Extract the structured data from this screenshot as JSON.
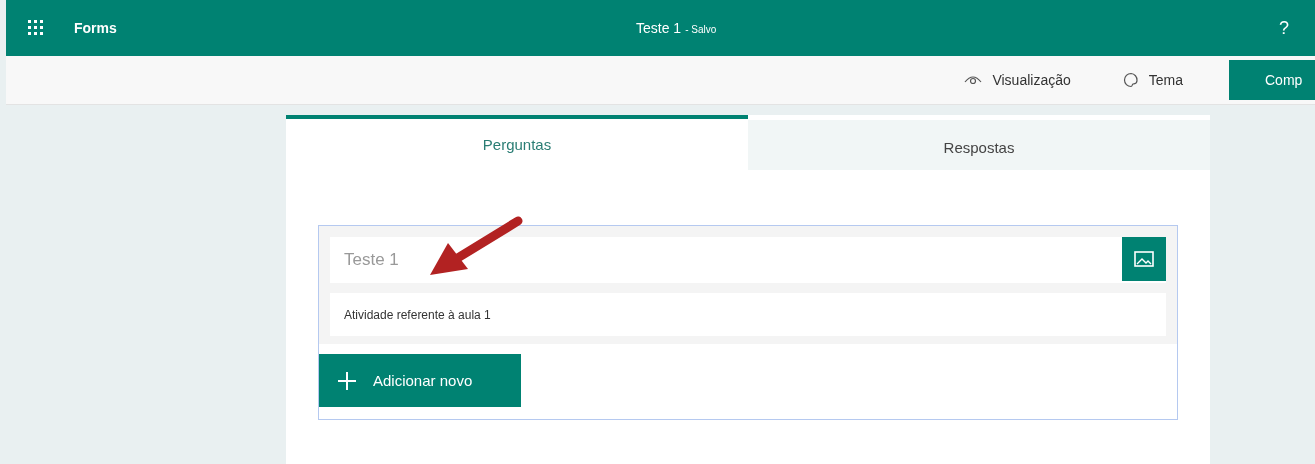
{
  "header": {
    "app_name": "Forms",
    "title": "Teste 1",
    "status": "- Salvo",
    "help": "?"
  },
  "toolbar": [
    {
      "kind": "preview",
      "label": "Visualização"
    },
    {
      "kind": "theme",
      "label": "Tema"
    },
    {
      "kind": "primary",
      "label": "Comp"
    }
  ],
  "tabs": [
    {
      "label": "Perguntas",
      "selected": true
    },
    {
      "label": "Respostas",
      "selected": false
    }
  ],
  "form": {
    "title": "Teste 1",
    "description": "Atividade referente à aula 1",
    "add_button": "Adicionar novo"
  }
}
